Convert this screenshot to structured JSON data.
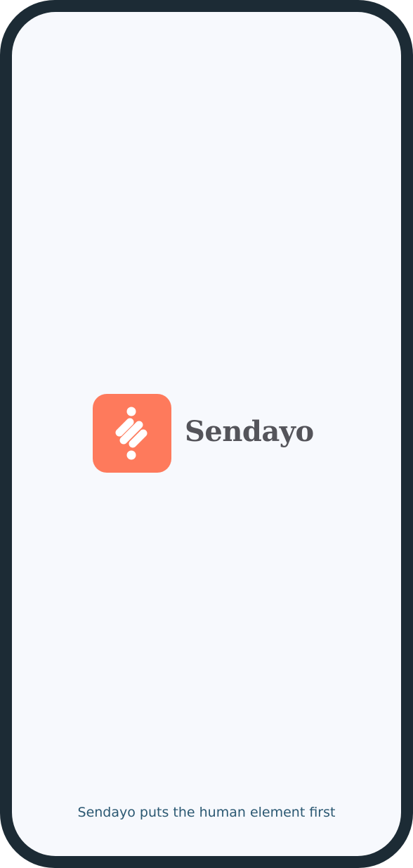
{
  "app": {
    "name": "Sendayo",
    "logo_icon": "sendayo-logo-icon",
    "tagline": "Sendayo puts the human element first"
  },
  "colors": {
    "device_frame": "#1c2b35",
    "screen_background": "#f7f9fd",
    "brand_accent": "#fe7a5c",
    "wordmark": "#54545a",
    "tagline": "#2b5872"
  }
}
